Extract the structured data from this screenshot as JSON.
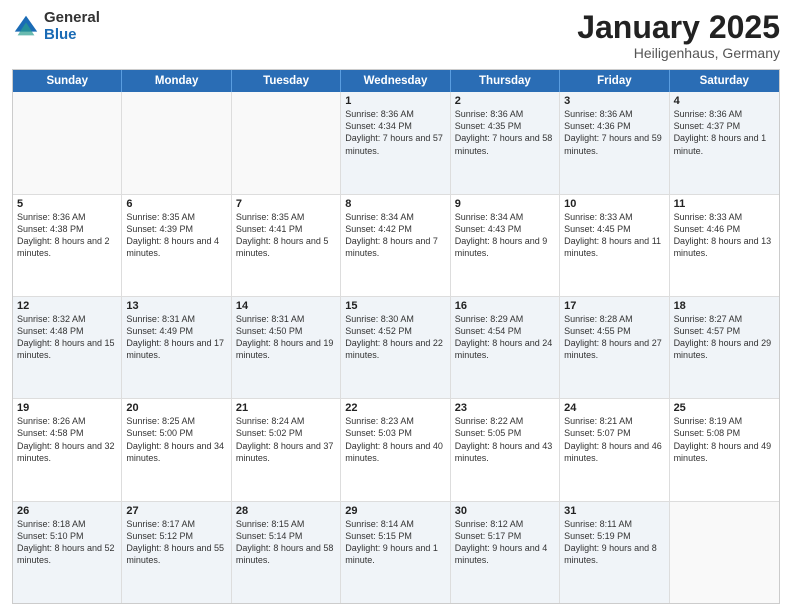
{
  "logo": {
    "general": "General",
    "blue": "Blue"
  },
  "title": {
    "month": "January 2025",
    "location": "Heiligenhaus, Germany"
  },
  "weekdays": [
    "Sunday",
    "Monday",
    "Tuesday",
    "Wednesday",
    "Thursday",
    "Friday",
    "Saturday"
  ],
  "rows": [
    [
      {
        "day": "",
        "text": ""
      },
      {
        "day": "",
        "text": ""
      },
      {
        "day": "",
        "text": ""
      },
      {
        "day": "1",
        "text": "Sunrise: 8:36 AM\nSunset: 4:34 PM\nDaylight: 7 hours and 57 minutes."
      },
      {
        "day": "2",
        "text": "Sunrise: 8:36 AM\nSunset: 4:35 PM\nDaylight: 7 hours and 58 minutes."
      },
      {
        "day": "3",
        "text": "Sunrise: 8:36 AM\nSunset: 4:36 PM\nDaylight: 7 hours and 59 minutes."
      },
      {
        "day": "4",
        "text": "Sunrise: 8:36 AM\nSunset: 4:37 PM\nDaylight: 8 hours and 1 minute."
      }
    ],
    [
      {
        "day": "5",
        "text": "Sunrise: 8:36 AM\nSunset: 4:38 PM\nDaylight: 8 hours and 2 minutes."
      },
      {
        "day": "6",
        "text": "Sunrise: 8:35 AM\nSunset: 4:39 PM\nDaylight: 8 hours and 4 minutes."
      },
      {
        "day": "7",
        "text": "Sunrise: 8:35 AM\nSunset: 4:41 PM\nDaylight: 8 hours and 5 minutes."
      },
      {
        "day": "8",
        "text": "Sunrise: 8:34 AM\nSunset: 4:42 PM\nDaylight: 8 hours and 7 minutes."
      },
      {
        "day": "9",
        "text": "Sunrise: 8:34 AM\nSunset: 4:43 PM\nDaylight: 8 hours and 9 minutes."
      },
      {
        "day": "10",
        "text": "Sunrise: 8:33 AM\nSunset: 4:45 PM\nDaylight: 8 hours and 11 minutes."
      },
      {
        "day": "11",
        "text": "Sunrise: 8:33 AM\nSunset: 4:46 PM\nDaylight: 8 hours and 13 minutes."
      }
    ],
    [
      {
        "day": "12",
        "text": "Sunrise: 8:32 AM\nSunset: 4:48 PM\nDaylight: 8 hours and 15 minutes."
      },
      {
        "day": "13",
        "text": "Sunrise: 8:31 AM\nSunset: 4:49 PM\nDaylight: 8 hours and 17 minutes."
      },
      {
        "day": "14",
        "text": "Sunrise: 8:31 AM\nSunset: 4:50 PM\nDaylight: 8 hours and 19 minutes."
      },
      {
        "day": "15",
        "text": "Sunrise: 8:30 AM\nSunset: 4:52 PM\nDaylight: 8 hours and 22 minutes."
      },
      {
        "day": "16",
        "text": "Sunrise: 8:29 AM\nSunset: 4:54 PM\nDaylight: 8 hours and 24 minutes."
      },
      {
        "day": "17",
        "text": "Sunrise: 8:28 AM\nSunset: 4:55 PM\nDaylight: 8 hours and 27 minutes."
      },
      {
        "day": "18",
        "text": "Sunrise: 8:27 AM\nSunset: 4:57 PM\nDaylight: 8 hours and 29 minutes."
      }
    ],
    [
      {
        "day": "19",
        "text": "Sunrise: 8:26 AM\nSunset: 4:58 PM\nDaylight: 8 hours and 32 minutes."
      },
      {
        "day": "20",
        "text": "Sunrise: 8:25 AM\nSunset: 5:00 PM\nDaylight: 8 hours and 34 minutes."
      },
      {
        "day": "21",
        "text": "Sunrise: 8:24 AM\nSunset: 5:02 PM\nDaylight: 8 hours and 37 minutes."
      },
      {
        "day": "22",
        "text": "Sunrise: 8:23 AM\nSunset: 5:03 PM\nDaylight: 8 hours and 40 minutes."
      },
      {
        "day": "23",
        "text": "Sunrise: 8:22 AM\nSunset: 5:05 PM\nDaylight: 8 hours and 43 minutes."
      },
      {
        "day": "24",
        "text": "Sunrise: 8:21 AM\nSunset: 5:07 PM\nDaylight: 8 hours and 46 minutes."
      },
      {
        "day": "25",
        "text": "Sunrise: 8:19 AM\nSunset: 5:08 PM\nDaylight: 8 hours and 49 minutes."
      }
    ],
    [
      {
        "day": "26",
        "text": "Sunrise: 8:18 AM\nSunset: 5:10 PM\nDaylight: 8 hours and 52 minutes."
      },
      {
        "day": "27",
        "text": "Sunrise: 8:17 AM\nSunset: 5:12 PM\nDaylight: 8 hours and 55 minutes."
      },
      {
        "day": "28",
        "text": "Sunrise: 8:15 AM\nSunset: 5:14 PM\nDaylight: 8 hours and 58 minutes."
      },
      {
        "day": "29",
        "text": "Sunrise: 8:14 AM\nSunset: 5:15 PM\nDaylight: 9 hours and 1 minute."
      },
      {
        "day": "30",
        "text": "Sunrise: 8:12 AM\nSunset: 5:17 PM\nDaylight: 9 hours and 4 minutes."
      },
      {
        "day": "31",
        "text": "Sunrise: 8:11 AM\nSunset: 5:19 PM\nDaylight: 9 hours and 8 minutes."
      },
      {
        "day": "",
        "text": ""
      }
    ]
  ]
}
